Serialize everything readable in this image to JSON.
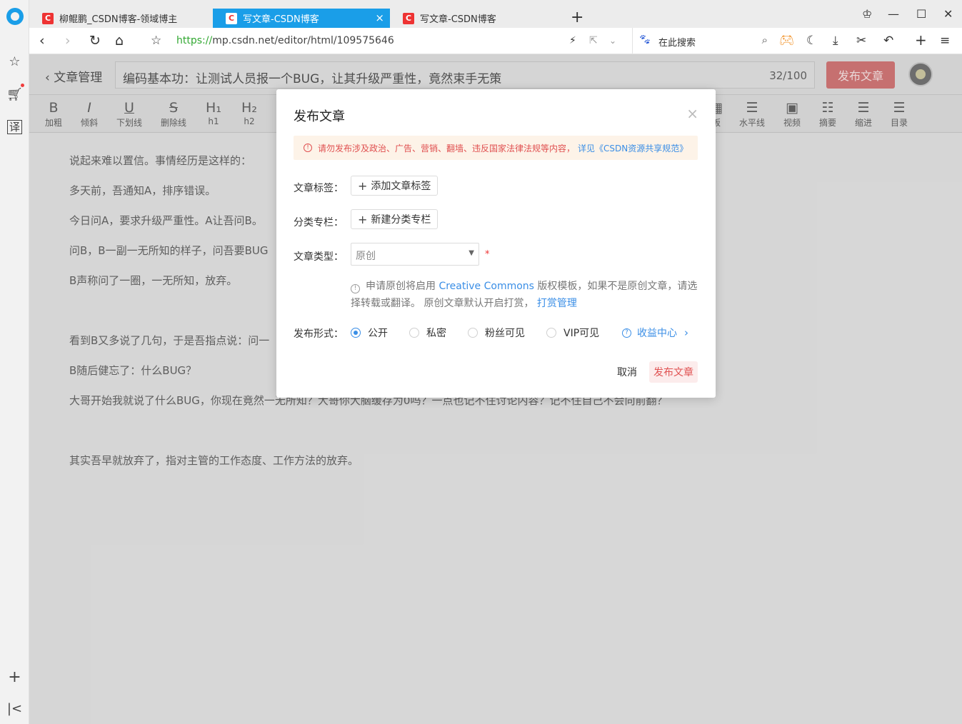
{
  "browser": {
    "tabs": [
      {
        "label": "柳鲲鹏_CSDN博客-领域博主",
        "favicon": "C"
      },
      {
        "label": "写文章-CSDN博客",
        "favicon": "C"
      },
      {
        "label": "写文章-CSDN博客",
        "favicon": "C"
      }
    ],
    "tab_close": "×",
    "new_tab": "+",
    "url_proto": "https://",
    "url_rest": "mp.csdn.net/editor/html/109575646",
    "search_label": "在此搜索",
    "accent_color": "#1a9ee8"
  },
  "sidebar": {
    "translate": "译",
    "add": "+"
  },
  "editor": {
    "back_label": "文章管理",
    "title_value": "编码基本功：让测试人员报一个BUG，让其升级严重性，竟然束手无策",
    "title_count": "32/100",
    "publish_top": "发布文章",
    "toolbar": [
      {
        "glyph": "B",
        "label": "加粗"
      },
      {
        "glyph": "I",
        "label": "倾斜"
      },
      {
        "glyph": "U",
        "label": "下划线"
      },
      {
        "glyph": "S",
        "label": "删除线"
      },
      {
        "glyph": "H₁",
        "label": "h1"
      },
      {
        "glyph": "H₂",
        "label": "h2"
      },
      {
        "glyph": "▦",
        "label": "板"
      },
      {
        "glyph": "☰",
        "label": "水平线"
      },
      {
        "glyph": "▣",
        "label": "视频"
      },
      {
        "glyph": "☷",
        "label": "摘要"
      },
      {
        "glyph": "☰",
        "label": "缩进"
      },
      {
        "glyph": "☰",
        "label": "目录"
      }
    ],
    "paragraphs": [
      "说起来难以置信。事情经历是这样的：",
      "多天前，吾通知A，排序错误。",
      "今日问A，要求升级严重性。A让吾问B。",
      "问B，B一副一无所知的样子，问吾要BUG",
      "B声称问了一圈，一无所知，放弃。",
      "看到B又多说了几句，于是吾指点说：问一",
      "B随后健忘了：什么BUG？",
      "大哥开始我就说了什么BUG，你现在竟然一无所知？大哥你大脑缓存为0吗？一点也记不住讨论内容？记不住自己不会向前翻？",
      "其实吾早就放弃了，指对主管的工作态度、工作方法的放弃。"
    ]
  },
  "modal": {
    "title": "发布文章",
    "close": "×",
    "warning_icon": "!",
    "warning_text": "请勿发布涉及政治、广告、营销、翻墙、违反国家法律法规等内容，",
    "warning_link": "详见《CSDN资源共享规范》",
    "tags_label": "文章标签：",
    "tags_button": "添加文章标签",
    "column_label": "分类专栏：",
    "column_button": "新建分类专栏",
    "type_label": "文章类型：",
    "type_value": "原创",
    "required_mark": "*",
    "hint_icon": "!",
    "hint_pre": "申请原创将启用 ",
    "hint_cc": "Creative Commons",
    "hint_mid": " 版权模板，如果不是原创文章，请选择转载或翻译。 原创文章默认开启打赏，",
    "hint_reward": "打赏管理",
    "form_label": "发布形式：",
    "options": [
      "公开",
      "私密",
      "粉丝可见",
      "VIP可见"
    ],
    "selected_option": "公开",
    "earnings_icon": "?",
    "earnings_label": "收益中心",
    "cancel": "取消",
    "publish": "发布文章",
    "accent_color": "#3a8ee6",
    "danger_color": "#e05252"
  }
}
